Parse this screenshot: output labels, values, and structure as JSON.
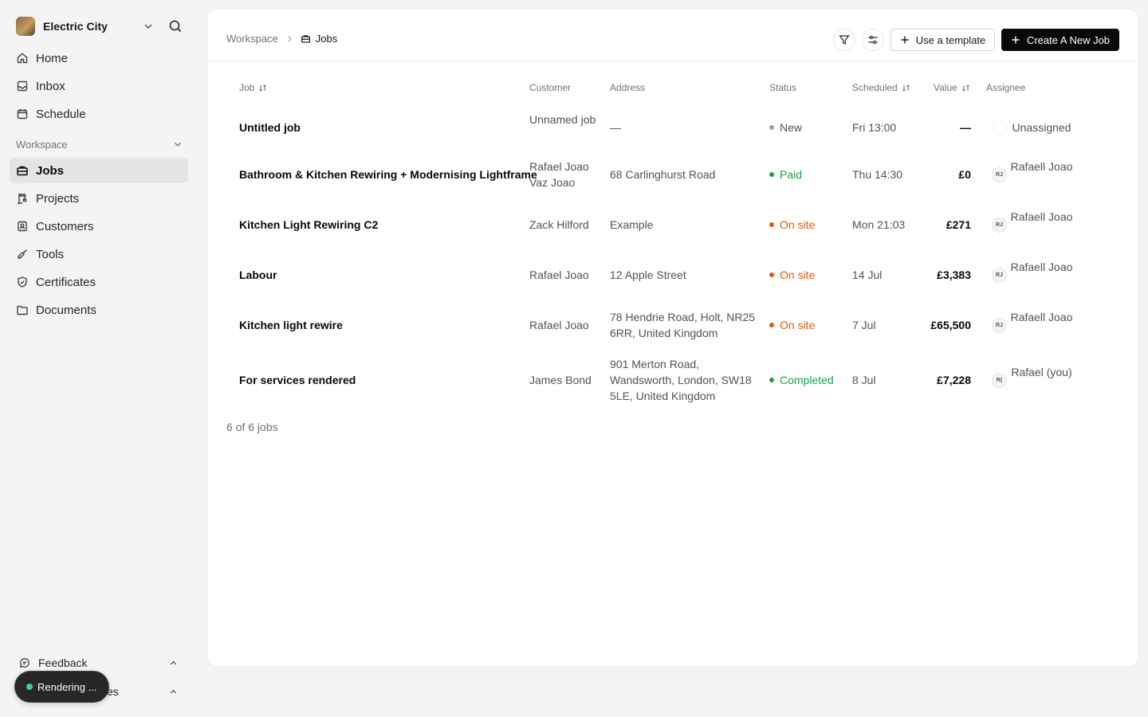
{
  "sidebar": {
    "org_name": "Electric City",
    "nav": [
      {
        "label": "Home",
        "icon": "home-icon"
      },
      {
        "label": "Inbox",
        "icon": "inbox-icon"
      },
      {
        "label": "Schedule",
        "icon": "calendar-icon"
      }
    ],
    "section_label": "Workspace",
    "workspace_items": [
      {
        "label": "Jobs",
        "icon": "briefcase-icon",
        "active": true
      },
      {
        "label": "Projects",
        "icon": "crane-icon"
      },
      {
        "label": "Customers",
        "icon": "contact-icon"
      },
      {
        "label": "Tools",
        "icon": "screwdriver-icon"
      },
      {
        "label": "Certificates",
        "icon": "shield-check-icon"
      },
      {
        "label": "Documents",
        "icon": "folder-icon"
      }
    ],
    "bottom": {
      "feedback_label": "Feedback",
      "second_label": "ces"
    },
    "toast_label": "Rendering ..."
  },
  "header": {
    "breadcrumb_root": "Workspace",
    "breadcrumb_current": "Jobs",
    "template_button": "Use a template",
    "create_button": "Create A New Job"
  },
  "table": {
    "columns": {
      "job": "Job",
      "customer": "Customer",
      "address": "Address",
      "status": "Status",
      "scheduled": "Scheduled",
      "value": "Value",
      "assignee": "Assignee"
    },
    "rows": [
      {
        "job": "Untitled job",
        "customer": "Unnamed job",
        "address": "—",
        "status": "New",
        "status_color": "#a1a1aa",
        "scheduled": "Fri 13:00",
        "value": "—",
        "avatar": "",
        "assignee": "Unassigned"
      },
      {
        "job": "Bathroom & Kitchen Rewiring + Modernising Lightframe",
        "customer": "Rafael Joao Vaz Joao",
        "address": "68 Carlinghurst Road",
        "status": "Paid",
        "status_color": "#16a34a",
        "scheduled": "Thu 14:30",
        "value": "£0",
        "avatar": "RJ",
        "assignee": "Rafaell Joao"
      },
      {
        "job": "Kitchen Light Rewiring C2",
        "customer": "Zack Hilford",
        "address": "Example",
        "status": "On site",
        "status_color": "#ea580c",
        "scheduled": "Mon 21:03",
        "value": "£271",
        "avatar": "RJ",
        "assignee": "Rafaell Joao"
      },
      {
        "job": "Labour",
        "customer": "Rafael Joao",
        "address": "12 Apple Street",
        "status": "On site",
        "status_color": "#ea580c",
        "scheduled": "14 Jul",
        "value": "£3,383",
        "avatar": "RJ",
        "assignee": "Rafaell Joao"
      },
      {
        "job": "Kitchen light rewire",
        "customer": "Rafael Joao",
        "address": "78 Hendrie Road, Holt, NR25 6RR, United Kingdom",
        "status": "On site",
        "status_color": "#ea580c",
        "scheduled": "7 Jul",
        "value": "£65,500",
        "avatar": "RJ",
        "assignee": "Rafaell Joao"
      },
      {
        "job": "For services rendered",
        "customer": "James Bond",
        "address": "901 Merton Road, Wandsworth, London, SW18 5LE, United Kingdom",
        "status": "Completed",
        "status_color": "#16a34a",
        "scheduled": "8 Jul",
        "value": "£7,228",
        "avatar": "R(",
        "assignee": "Rafael (you)"
      }
    ],
    "footer_count": "6 of 6 jobs"
  }
}
